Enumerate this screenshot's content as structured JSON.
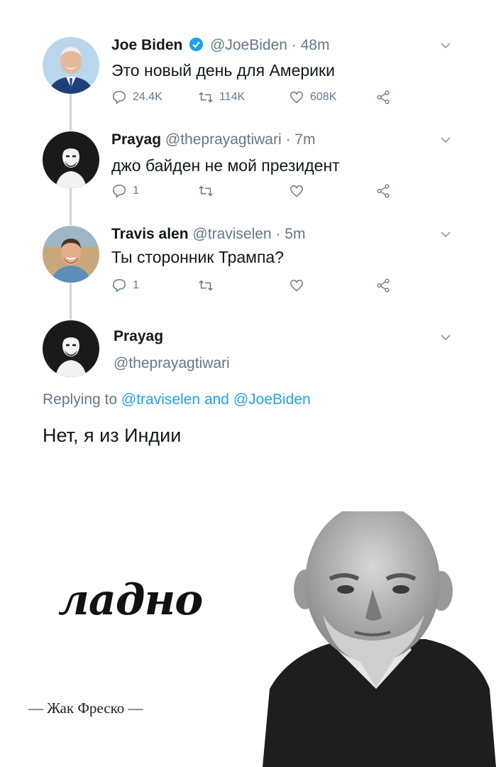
{
  "tweets": [
    {
      "name": "Joe Biden",
      "verified": true,
      "handle_time": "@JoeBiden · 48m",
      "text": "Это новый день для Америки",
      "replies": "24.4K",
      "retweets": "114K",
      "likes": "608K"
    },
    {
      "name": "Prayag",
      "handle_time": "@theprayagtiwari · 7m",
      "text": "джо байден не мой президент",
      "replies": "1",
      "retweets": "",
      "likes": ""
    },
    {
      "name": "Travis alen",
      "handle_time": "@traviselen · 5m",
      "text": "Ты сторонник Трампа?",
      "replies": "1",
      "retweets": "",
      "likes": ""
    }
  ],
  "main_tweet": {
    "name": "Prayag",
    "handle": "@theprayagtiwari",
    "replying_prefix": "Replying to",
    "reply_user1": "@traviselen",
    "reply_and": "and",
    "reply_user2": "@JoeBiden",
    "text": "Нет, я из Индии"
  },
  "meme": {
    "caption": "ладно",
    "signature": "— Жак Фреско —"
  },
  "colors": {
    "accent": "#1da1f2",
    "muted": "#657786",
    "verified": "#1da1f2",
    "thread_line": "#ccd6dd"
  }
}
